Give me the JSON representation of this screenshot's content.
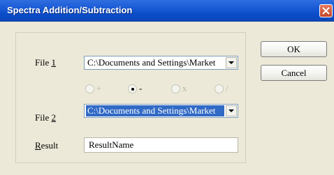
{
  "window": {
    "title": "Spectra Addition/Subtraction"
  },
  "form": {
    "file1": {
      "label_prefix": "File ",
      "label_mnemonic": "1",
      "value": "C:\\Documents and Settings\\Market"
    },
    "operations": [
      {
        "symbol": "+",
        "selected": false,
        "enabled": false
      },
      {
        "symbol": "-",
        "selected": true,
        "enabled": true
      },
      {
        "symbol": "x",
        "selected": false,
        "enabled": false
      },
      {
        "symbol": "/",
        "selected": false,
        "enabled": false
      }
    ],
    "file2": {
      "label_prefix": "File ",
      "label_mnemonic": "2",
      "value": "C:\\Documents and Settings\\Market"
    },
    "result": {
      "label_mnemonic": "R",
      "label_rest": "esult",
      "value": "ResultName"
    }
  },
  "buttons": {
    "ok": "OK",
    "cancel": "Cancel"
  },
  "icons": {
    "close": "close-icon",
    "dropdown": "chevron-down-icon"
  }
}
